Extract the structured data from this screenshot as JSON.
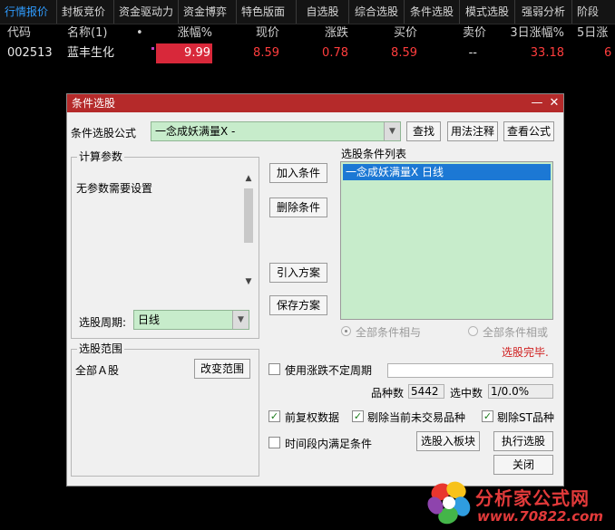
{
  "menu": [
    "行情报价",
    "封板竞价",
    "资金驱动力",
    "资金博弈",
    "特色版面",
    "自选股",
    "综合选股",
    "条件选股",
    "模式选股",
    "强弱分析",
    "阶段"
  ],
  "quote_header": {
    "code": "代码",
    "name": "名称(1)",
    "dot": "•",
    "pct": "涨幅%",
    "price": "现价",
    "change": "涨跌",
    "bid": "买价",
    "ask": "卖价",
    "pct3d": "3日涨幅%",
    "pct5d": "5日涨"
  },
  "quote_row": {
    "code": "002513",
    "name": "蓝丰生化",
    "pct": "9.99",
    "price": "8.59",
    "change": "0.78",
    "bid": "8.59",
    "ask": "--",
    "pct3d": "33.18",
    "pct5d": "6"
  },
  "dialog": {
    "title": "条件选股",
    "minimize": "—",
    "close": "✕",
    "formula_label": "条件选股公式",
    "formula_value": "一念成妖满量X  -",
    "find_btn": "查找",
    "usage_btn": "用法注释",
    "view_btn": "查看公式",
    "params_title": "计算参数",
    "params_text": "无参数需要设置",
    "period_label": "选股周期:",
    "period_value": "日线",
    "add_btn": "加入条件",
    "delete_btn": "删除条件",
    "import_btn": "引入方案",
    "save_btn": "保存方案",
    "list_title": "选股条件列表",
    "list_items": [
      "一念成妖满量X  日线"
    ],
    "radio_and": "全部条件相与",
    "radio_or": "全部条件相或",
    "status": "选股完毕.",
    "range_title": "选股范围",
    "range_value": "全部Ａ股",
    "change_range_btn": "改变范围",
    "uncertain_period_label": "使用涨跌不定周期",
    "count_label": "品种数",
    "count_value": "5442",
    "selected_label": "选中数",
    "selected_value": "1/0.0%",
    "fq_label": "前复权数据",
    "exclude_untraded_label": "剔除当前未交易品种",
    "exclude_st_label": "剔除ST品种",
    "time_period_label": "时间段内满足条件",
    "to_block_btn": "选股入板块",
    "execute_btn": "执行选股",
    "close_btn": "关闭"
  },
  "watermark": {
    "text": "分析家公式网",
    "url": "www.70822.com"
  },
  "colors": {
    "accent": "#2f9cff",
    "up": "#ff3d3d",
    "title_bar": "#b52a2a",
    "list_bg": "#c7eccb",
    "selected": "#1c78d4"
  }
}
